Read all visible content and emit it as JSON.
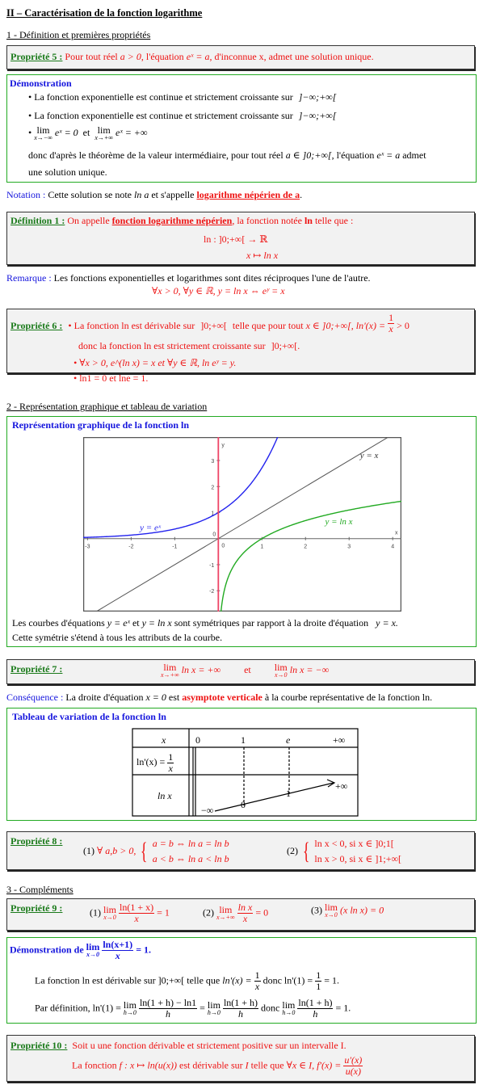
{
  "title": "II – Caractérisation de la fonction logarithme",
  "sections": {
    "s1": "1 - Définition et premières propriétés",
    "s2": "2 - Représentation graphique et tableau de variation",
    "s3": "3 - Compléments"
  },
  "prop5": {
    "label": "Propriété 5 :",
    "text_a": "Pour tout réel",
    "math_a": "a > 0",
    "text_b": ", l'équation",
    "math_b": "eˣ = a",
    "text_c": ", d'inconnue x, admet une solution unique."
  },
  "demo1": {
    "title": "Démonstration",
    "bullet1": "La fonction exponentielle est continue et strictement croissante sur",
    "interval1": "]−∞;+∞[",
    "bullet2": "La fonction exponentielle est continue et strictement croissante sur",
    "interval2": "]−∞;+∞[",
    "lim1_expr": "eˣ = 0",
    "lim1_sub": "x→−∞",
    "et": "et",
    "lim2_expr": "eˣ = +∞",
    "lim2_sub": "x→+∞",
    "lim_word": "lim",
    "conclusion_a": "donc d'après le théorème de la valeur intermédiaire, pour tout réel",
    "conclusion_math": "a ∈ ]0;+∞[",
    "conclusion_b": ", l'équation",
    "conclusion_eq": "eˣ = a",
    "conclusion_c": "admet",
    "conclusion_d": "une solution unique."
  },
  "notation": {
    "label": "Notation :",
    "text_a": "Cette solution se note",
    "math": "ln a",
    "text_b": "et s'appelle",
    "highlight": "logarithme népérien de a",
    "end": "."
  },
  "def1": {
    "label": "Définition 1 :",
    "text_a": "On appelle",
    "highlight": "fonction logarithme népérien",
    "text_b": ", la fonction notée",
    "ln": "ln",
    "text_c": "telle que :",
    "map1": "ln : ]0;+∞[ → ℝ",
    "map2": "x ↦ ln x"
  },
  "remarque": {
    "label": "Remarque :",
    "text": "Les fonctions exponentielles et logarithmes sont dites réciproques l'une de l'autre.",
    "formula": "∀x > 0, ∀y ∈ ℝ, y = ln x ⇔ eʸ = x"
  },
  "prop6": {
    "label": "Propriété 6 :",
    "l1_a": "• La fonction ln est dérivable sur",
    "l1_interval": "]0;+∞[",
    "l1_b": "telle que pour tout",
    "l1_c": "x ∈ ]0;+∞[, ln'(x) =",
    "l1_num": "1",
    "l1_den": "x",
    "l1_d": "> 0",
    "l2": "donc la fonction ln est strictement croissante sur",
    "l2_interval": "]0;+∞[.",
    "l3": "• ∀x > 0, e^(ln x) = x   et   ∀y ∈ ℝ, ln eʸ = y.",
    "l4": "• ln1 = 0  et  lne = 1."
  },
  "graph": {
    "title": "Représentation graphique de la fonction ln",
    "labels": {
      "exp": "y = eˣ",
      "ln": "y = ln x",
      "id": "y = x",
      "x_axis": "x",
      "y_axis": "y",
      "origin": "0"
    },
    "caption1_a": "Les courbes d'équations",
    "caption1_m1": "y = eˣ",
    "caption1_b": "et",
    "caption1_m2": "y = ln x",
    "caption1_c": "sont symétriques par rapport à la droite d'équation",
    "caption1_m3": "y = x.",
    "caption2": "Cette symétrie s'étend à tous les attributs de la courbe."
  },
  "chart_data": {
    "type": "line",
    "title": "",
    "xlim": [
      -3.1,
      4.2
    ],
    "ylim": [
      -2.8,
      3.9
    ],
    "x_ticks": [
      -3,
      -2,
      -1,
      0,
      1,
      2,
      3,
      4
    ],
    "x_tick_labels": [
      "-3",
      "-2",
      "-1",
      "0",
      "1",
      "2",
      "3",
      "4"
    ],
    "y_ticks": [
      -2,
      -1,
      0,
      1,
      2,
      3
    ],
    "y_tick_labels": [
      "-2",
      "-1",
      "0",
      "1",
      "2",
      "3"
    ],
    "xlabel": "x",
    "ylabel": "y",
    "series": [
      {
        "name": "y = e^x",
        "function": "exp",
        "color": "#2222ee"
      },
      {
        "name": "y = ln x",
        "function": "ln",
        "color": "#22aa22"
      },
      {
        "name": "y = x",
        "function": "identity",
        "color": "#555555"
      },
      {
        "name": "asymptote x = 0",
        "function": "vertical_x0",
        "color": "#ee4466"
      }
    ],
    "grid": false
  },
  "prop7": {
    "label": "Propriété 7 :",
    "lim_word": "lim",
    "lim1_sub": "x→+∞",
    "lim1_expr": "ln x = +∞",
    "et": "et",
    "lim2_sub": "x→0",
    "lim2_expr": "ln x = −∞"
  },
  "consequence": {
    "label": "Conséquence :",
    "text_a": "La droite d'équation",
    "math": "x = 0",
    "text_b": "est",
    "highlight": "asymptote verticale",
    "text_c": "à la courbe représentative de la fonction ln."
  },
  "variation": {
    "title": "Tableau de variation de la fonction ln",
    "row1_head": "x",
    "row1_values": [
      "0",
      "1",
      "e",
      "+∞"
    ],
    "row2_head_a": "ln'(x) =",
    "row2_num": "1",
    "row2_den": "x",
    "row3_head": "ln x",
    "row3_values": [
      "−∞",
      "0",
      "1",
      "+∞"
    ]
  },
  "prop8": {
    "label": "Propriété 8 :",
    "p1_num": "(1)",
    "p1_quant": "∀ a,b > 0,",
    "p1_l1": "a = b ⇔ ln a = ln b",
    "p1_l2": "a < b ⇔ ln a < ln b",
    "p2_num": "(2)",
    "p2_l1": "ln x < 0, si  x ∈ ]0;1[",
    "p2_l2": "ln x > 0, si  x ∈ ]1;+∞["
  },
  "prop9": {
    "label": "Propriété 9 :",
    "lim_word": "lim",
    "p1_num": "(1)",
    "p1_sub": "x→0",
    "p1_num_expr": "ln(1 + x)",
    "p1_den": "x",
    "p1_res": "= 1",
    "p2_num": "(2)",
    "p2_sub": "x→+∞",
    "p2_num_expr": "ln x",
    "p2_den": "x",
    "p2_res": "= 0",
    "p3_num": "(3)",
    "p3_sub": "x→0",
    "p3_expr": "(x ln x) = 0"
  },
  "demo2": {
    "title_a": "Démonstration de",
    "lim_word": "lim",
    "title_sub": "x→0",
    "title_num": "ln(x+1)",
    "title_den": "x",
    "title_res": "= 1.",
    "l1_a": "La fonction ln est dérivable sur",
    "l1_interval": "]0;+∞[",
    "l1_b": "telle que",
    "l1_c": "ln'(x) =",
    "l1_num": "1",
    "l1_den": "x",
    "l1_d": "donc",
    "l1_e": "ln'(1) =",
    "l1_num2": "1",
    "l1_den2": "1",
    "l1_f": "= 1.",
    "l2_a": "Par définition,",
    "l2_b": "ln'(1) =",
    "l2_sub": "h→0",
    "l2_f1_num": "ln(1 + h) − ln1",
    "l2_f1_den": "h",
    "l2_eq": "=",
    "l2_f2_num": "ln(1 + h)",
    "l2_f2_den": "h",
    "l2_donc": "donc",
    "l2_f3_num": "ln(1 + h)",
    "l2_f3_den": "h",
    "l2_res": "= 1."
  },
  "prop10": {
    "label": "Propriété 10 :",
    "l1": "Soit u une fonction dérivable et strictement positive sur un intervalle I.",
    "l2_a": "La fonction",
    "l2_b": "f : x ↦ ln(u(x))",
    "l2_c": "est dérivable sur",
    "l2_d": "I",
    "l2_e": "telle que",
    "l2_f": "∀x ∈ I, f'(x) =",
    "l2_num": "u'(x)",
    "l2_den": "u(x)"
  }
}
